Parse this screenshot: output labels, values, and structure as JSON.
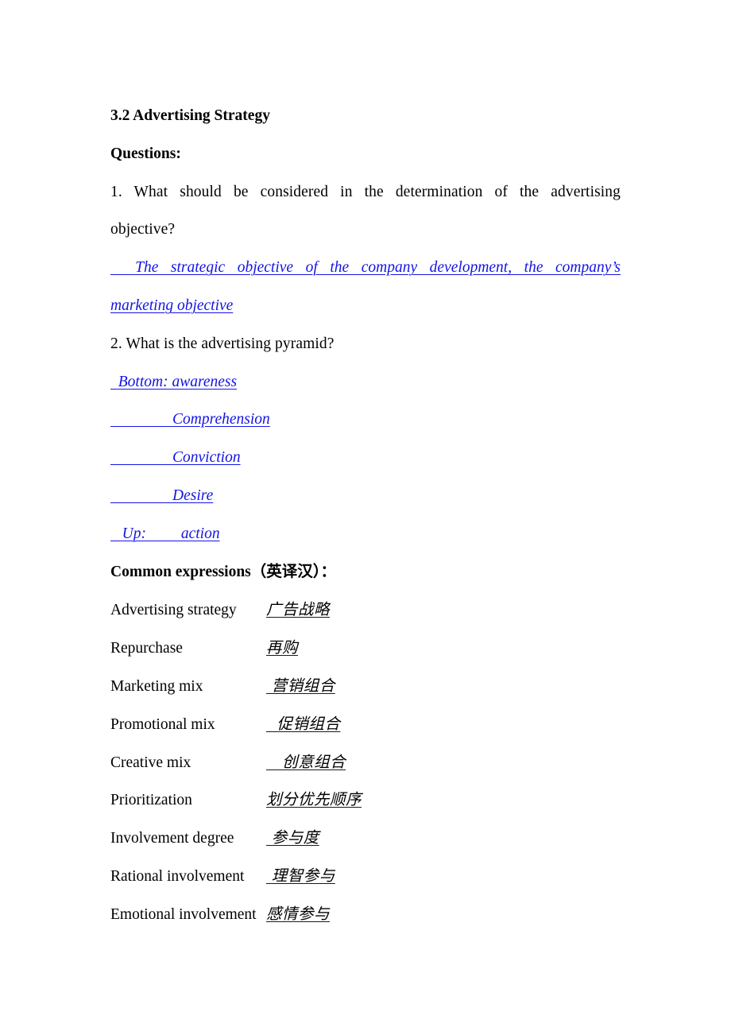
{
  "document": {
    "section_heading": "3.2 Advertising Strategy",
    "questions_label": "Questions:",
    "questions": [
      {
        "number": "1.",
        "text": "1. What should be considered in the determination of the advertising objective?",
        "line1": "1. What should be considered in the determination of the advertising",
        "line2": "objective?",
        "answer_line1": "  The strategic objective of the company development, the company’s",
        "answer_line2": "marketing objective"
      },
      {
        "number": "2.",
        "text": "2. What is the advertising pyramid?",
        "answer_lines": [
          "  Bottom: awareness",
          "                Comprehension",
          "                Conviction",
          "                Desire",
          "   Up:         action"
        ]
      }
    ],
    "common_expressions": {
      "label": "Common expressions（英译汉）：",
      "rows": [
        {
          "english": "Advertising strategy",
          "chinese": "广告战略",
          "indent": ""
        },
        {
          "english": "Repurchase",
          "chinese": "再购",
          "indent": ""
        },
        {
          "english": "Marketing mix",
          "chinese": " 营销组合",
          "indent": " "
        },
        {
          "english": "Promotional mix",
          "chinese": "  促销组合",
          "indent": "  "
        },
        {
          "english": "Creative mix",
          "chinese": "   创意组合",
          "indent": "   "
        },
        {
          "english": "Prioritization",
          "chinese": "划分优先顺序",
          "indent": ""
        },
        {
          "english": "Involvement degree",
          "chinese": " 参与度",
          "indent": " "
        },
        {
          "english": "Rational involvement",
          "chinese": " 理智参与",
          "indent": " "
        },
        {
          "english": "Emotional involvement",
          "chinese": "感情参与",
          "indent": ""
        }
      ]
    }
  },
  "colors": {
    "answer_blue": "#1414E6",
    "text_black": "#000000",
    "page_background": "#FFFFFF"
  }
}
